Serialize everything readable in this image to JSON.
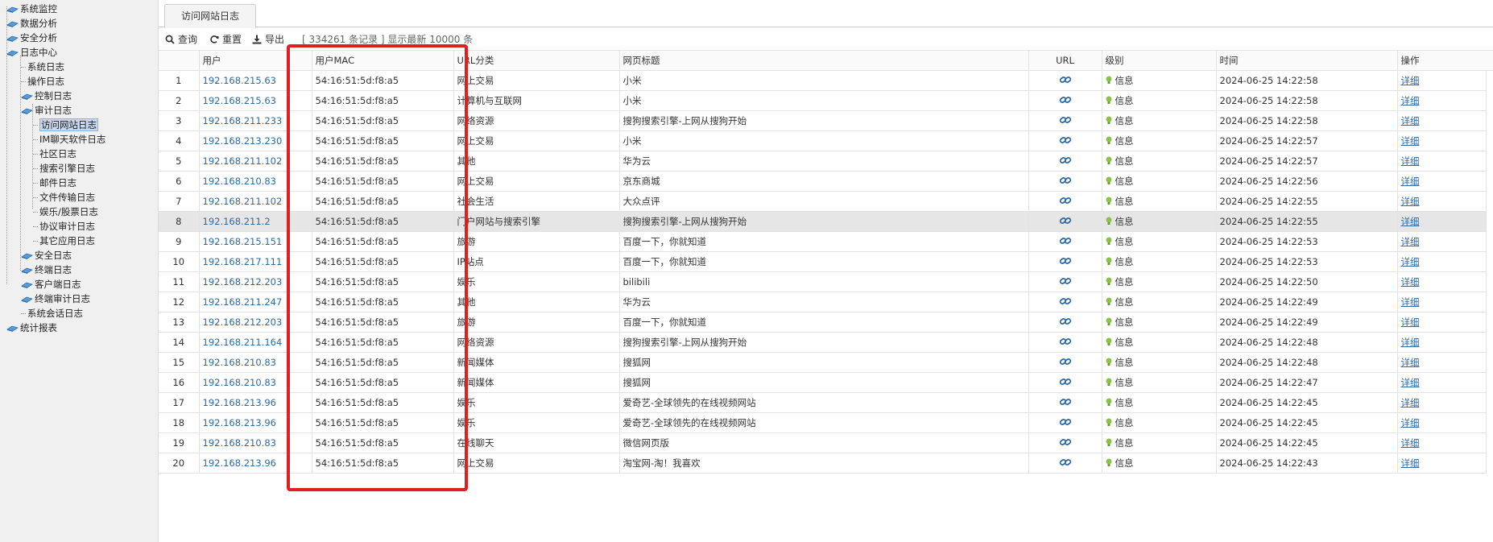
{
  "tree": {
    "items": [
      {
        "label": "系统监控"
      },
      {
        "label": "数据分析"
      },
      {
        "label": "安全分析"
      },
      {
        "label": "日志中心"
      },
      {
        "label": "系统日志"
      },
      {
        "label": "操作日志"
      },
      {
        "label": "控制日志"
      },
      {
        "label": "审计日志"
      },
      {
        "label": "访问网站日志"
      },
      {
        "label": "IM聊天软件日志"
      },
      {
        "label": "社区日志"
      },
      {
        "label": "搜索引擎日志"
      },
      {
        "label": "邮件日志"
      },
      {
        "label": "文件传输日志"
      },
      {
        "label": "娱乐/股票日志"
      },
      {
        "label": "协议审计日志"
      },
      {
        "label": "其它应用日志"
      },
      {
        "label": "安全日志"
      },
      {
        "label": "终端日志"
      },
      {
        "label": "客户端日志"
      },
      {
        "label": "终端审计日志"
      },
      {
        "label": "系统会话日志"
      },
      {
        "label": "统计报表"
      }
    ]
  },
  "tabs": {
    "active_label": "访问网站日志"
  },
  "toolbar": {
    "query_label": "查询",
    "reset_label": "重置",
    "export_label": "导出",
    "record_info": "[ 334261 条记录 ] 显示最新 10000 条"
  },
  "table": {
    "headers": {
      "user": "用户",
      "mac": "用户MAC",
      "category": "URL分类",
      "title": "网页标题",
      "url": "URL",
      "level": "级别",
      "time": "时间",
      "action": "操作"
    },
    "rows": [
      {
        "num": "1",
        "ip": "192.168.215.63",
        "mac": "54:16:51:5d:f8:a5",
        "category": "网上交易",
        "title": "小米",
        "level": "信息",
        "time": "2024-06-25 14:22:58",
        "action": "详细"
      },
      {
        "num": "2",
        "ip": "192.168.215.63",
        "mac": "54:16:51:5d:f8:a5",
        "category": "计算机与互联网",
        "title": "小米",
        "level": "信息",
        "time": "2024-06-25 14:22:58",
        "action": "详细"
      },
      {
        "num": "3",
        "ip": "192.168.211.233",
        "mac": "54:16:51:5d:f8:a5",
        "category": "网络资源",
        "title": "搜狗搜索引擎-上网从搜狗开始",
        "level": "信息",
        "time": "2024-06-25 14:22:58",
        "action": "详细"
      },
      {
        "num": "4",
        "ip": "192.168.213.230",
        "mac": "54:16:51:5d:f8:a5",
        "category": "网上交易",
        "title": "小米",
        "level": "信息",
        "time": "2024-06-25 14:22:57",
        "action": "详细"
      },
      {
        "num": "5",
        "ip": "192.168.211.102",
        "mac": "54:16:51:5d:f8:a5",
        "category": "其他",
        "title": "华为云",
        "level": "信息",
        "time": "2024-06-25 14:22:57",
        "action": "详细"
      },
      {
        "num": "6",
        "ip": "192.168.210.83",
        "mac": "54:16:51:5d:f8:a5",
        "category": "网上交易",
        "title": "京东商城",
        "level": "信息",
        "time": "2024-06-25 14:22:56",
        "action": "详细"
      },
      {
        "num": "7",
        "ip": "192.168.211.102",
        "mac": "54:16:51:5d:f8:a5",
        "category": "社会生活",
        "title": "大众点评",
        "level": "信息",
        "time": "2024-06-25 14:22:55",
        "action": "详细"
      },
      {
        "num": "8",
        "ip": "192.168.211.2",
        "mac": "54:16:51:5d:f8:a5",
        "category": "门户网站与搜索引擎",
        "title": "搜狗搜索引擎-上网从搜狗开始",
        "level": "信息",
        "time": "2024-06-25 14:22:55",
        "action": "详细"
      },
      {
        "num": "9",
        "ip": "192.168.215.151",
        "mac": "54:16:51:5d:f8:a5",
        "category": "旅游",
        "title": "百度一下，你就知道",
        "level": "信息",
        "time": "2024-06-25 14:22:53",
        "action": "详细"
      },
      {
        "num": "10",
        "ip": "192.168.217.111",
        "mac": "54:16:51:5d:f8:a5",
        "category": "IP站点",
        "title": "百度一下，你就知道",
        "level": "信息",
        "time": "2024-06-25 14:22:53",
        "action": "详细"
      },
      {
        "num": "11",
        "ip": "192.168.212.203",
        "mac": "54:16:51:5d:f8:a5",
        "category": "娱乐",
        "title": "bilibili",
        "level": "信息",
        "time": "2024-06-25 14:22:50",
        "action": "详细"
      },
      {
        "num": "12",
        "ip": "192.168.211.247",
        "mac": "54:16:51:5d:f8:a5",
        "category": "其他",
        "title": "华为云",
        "level": "信息",
        "time": "2024-06-25 14:22:49",
        "action": "详细"
      },
      {
        "num": "13",
        "ip": "192.168.212.203",
        "mac": "54:16:51:5d:f8:a5",
        "category": "旅游",
        "title": "百度一下，你就知道",
        "level": "信息",
        "time": "2024-06-25 14:22:49",
        "action": "详细"
      },
      {
        "num": "14",
        "ip": "192.168.211.164",
        "mac": "54:16:51:5d:f8:a5",
        "category": "网络资源",
        "title": "搜狗搜索引擎-上网从搜狗开始",
        "level": "信息",
        "time": "2024-06-25 14:22:48",
        "action": "详细"
      },
      {
        "num": "15",
        "ip": "192.168.210.83",
        "mac": "54:16:51:5d:f8:a5",
        "category": "新闻媒体",
        "title": "搜狐网",
        "level": "信息",
        "time": "2024-06-25 14:22:48",
        "action": "详细"
      },
      {
        "num": "16",
        "ip": "192.168.210.83",
        "mac": "54:16:51:5d:f8:a5",
        "category": "新闻媒体",
        "title": "搜狐网",
        "level": "信息",
        "time": "2024-06-25 14:22:47",
        "action": "详细"
      },
      {
        "num": "17",
        "ip": "192.168.213.96",
        "mac": "54:16:51:5d:f8:a5",
        "category": "娱乐",
        "title": "爱奇艺-全球领先的在线视频网站",
        "level": "信息",
        "time": "2024-06-25 14:22:45",
        "action": "详细"
      },
      {
        "num": "18",
        "ip": "192.168.213.96",
        "mac": "54:16:51:5d:f8:a5",
        "category": "娱乐",
        "title": "爱奇艺-全球领先的在线视频网站",
        "level": "信息",
        "time": "2024-06-25 14:22:45",
        "action": "详细"
      },
      {
        "num": "19",
        "ip": "192.168.210.83",
        "mac": "54:16:51:5d:f8:a5",
        "category": "在线聊天",
        "title": "微信网页版",
        "level": "信息",
        "time": "2024-06-25 14:22:45",
        "action": "详细"
      },
      {
        "num": "20",
        "ip": "192.168.213.96",
        "mac": "54:16:51:5d:f8:a5",
        "category": "网上交易",
        "title": "淘宝网-淘！我喜欢",
        "level": "信息",
        "time": "2024-06-25 14:22:43",
        "action": "详细"
      }
    ]
  },
  "icons": {
    "tree_folder": "book-icon",
    "url": "link-icon",
    "level": "lightbulb-icon",
    "query": "search-icon",
    "reset": "refresh-icon",
    "export": "download-icon"
  },
  "colors": {
    "link": "#2d6aa6",
    "highlight": "#e02020",
    "selected_row": "#e6e6e6",
    "bulb": "#8bc34a"
  }
}
